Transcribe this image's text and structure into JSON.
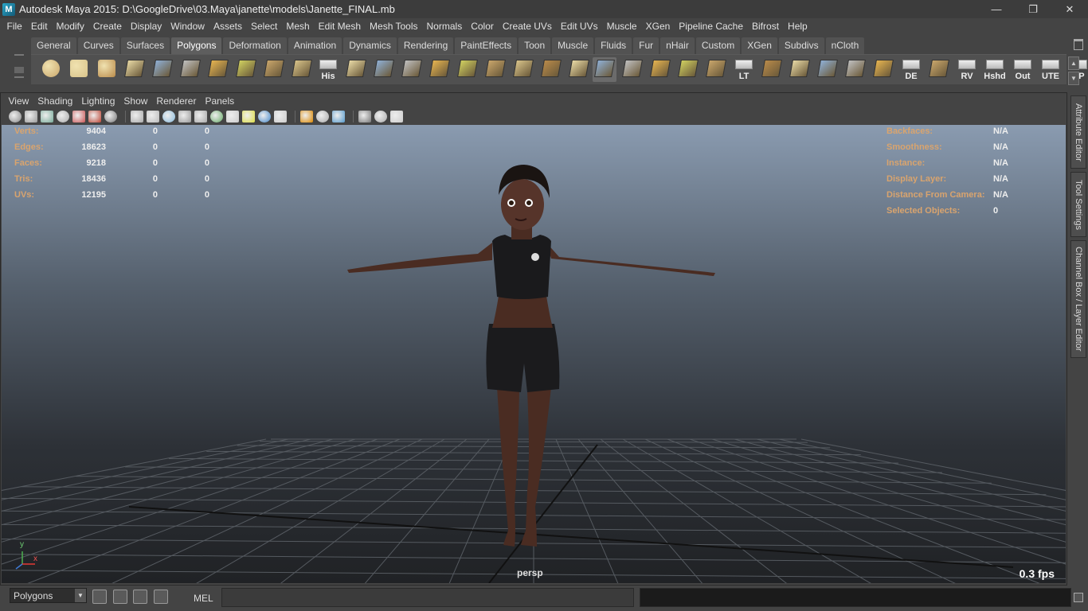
{
  "window": {
    "title": "Autodesk Maya 2015: D:\\GoogleDrive\\03.Maya\\janette\\models\\Janette_FINAL.mb",
    "app_icon": "maya-logo-icon",
    "controls": [
      "minimize-icon",
      "restore-icon",
      "close-icon"
    ]
  },
  "menubar": [
    "File",
    "Edit",
    "Modify",
    "Create",
    "Display",
    "Window",
    "Assets",
    "Select",
    "Mesh",
    "Edit Mesh",
    "Mesh Tools",
    "Normals",
    "Color",
    "Create UVs",
    "Edit UVs",
    "Muscle",
    "XGen",
    "Pipeline Cache",
    "Bifrost",
    "Help"
  ],
  "shelf": {
    "tabs": [
      "General",
      "Curves",
      "Surfaces",
      "Polygons",
      "Deformation",
      "Animation",
      "Dynamics",
      "Rendering",
      "PaintEffects",
      "Toon",
      "Muscle",
      "Fluids",
      "Fur",
      "nHair",
      "Custom",
      "XGen",
      "Subdivs",
      "nCloth"
    ],
    "active_tab": "Polygons",
    "icons": [
      {
        "name": "poly-sphere-icon",
        "label": ""
      },
      {
        "name": "poly-cube-icon",
        "label": ""
      },
      {
        "name": "poly-cylinder-icon",
        "label": ""
      },
      {
        "name": "poly-cone-icon",
        "label": ""
      },
      {
        "name": "poly-plane-icon",
        "label": ""
      },
      {
        "name": "poly-torus-icon",
        "label": ""
      },
      {
        "name": "poly-pyramid-icon",
        "label": ""
      },
      {
        "name": "poly-pipe-icon",
        "label": ""
      },
      {
        "name": "create-polygon-icon",
        "label": ""
      },
      {
        "name": "append-polygon-icon",
        "label": ""
      },
      {
        "name": "history-icon",
        "label": "His"
      },
      {
        "name": "extrude-icon",
        "label": ""
      },
      {
        "name": "bridge-icon",
        "label": ""
      },
      {
        "name": "append-icon",
        "label": ""
      },
      {
        "name": "split-icon",
        "label": ""
      },
      {
        "name": "insert-edgeloop-icon",
        "label": ""
      },
      {
        "name": "bevel-icon",
        "label": ""
      },
      {
        "name": "merge-icon",
        "label": ""
      },
      {
        "name": "wedge-icon",
        "label": ""
      },
      {
        "name": "soft-modification-icon",
        "label": ""
      },
      {
        "name": "sculpt-tool-icon",
        "label": ""
      },
      {
        "name": "lattice-icon",
        "label": ""
      },
      {
        "name": "move-manip-icon",
        "label": ""
      },
      {
        "name": "rotate-manip-icon",
        "label": ""
      },
      {
        "name": "object-space-icon",
        "label": ""
      },
      {
        "name": "lt-icon",
        "label": "LT"
      },
      {
        "name": "uv-map-icon-1",
        "label": ""
      },
      {
        "name": "uv-map-icon-2",
        "label": ""
      },
      {
        "name": "uv-map-icon-3",
        "label": ""
      },
      {
        "name": "uv-map-icon-4",
        "label": ""
      },
      {
        "name": "uv-map-icon-5",
        "label": ""
      },
      {
        "name": "de-icon",
        "label": "DE"
      },
      {
        "name": "uv-map-icon-6",
        "label": ""
      },
      {
        "name": "rv-icon",
        "label": "RV"
      },
      {
        "name": "hshd-icon",
        "label": "Hshd"
      },
      {
        "name": "out-icon",
        "label": "Out"
      },
      {
        "name": "ute-icon",
        "label": "UTE"
      },
      {
        "name": "cp-icon",
        "label": "CP"
      }
    ]
  },
  "panel": {
    "menu": [
      "View",
      "Shading",
      "Lighting",
      "Show",
      "Renderer",
      "Panels"
    ],
    "toolbar_icons": [
      "select-camera-icon",
      "camera-attributes-icon",
      "bookmarks-icon",
      "image-plane-icon",
      "grid-toggle-icon",
      "two-d-pan-icon",
      "grease-pencil-icon",
      "wireframe-icon",
      "smooth-shade-icon",
      "flat-shade-icon",
      "xray-icon",
      "texture-icon",
      "use-default-lights-icon",
      "shadows-icon",
      "ambient-occlusion-icon",
      "motion-blur-icon",
      "anti-alias-icon",
      "isolate-select-icon",
      "xray-joints-icon",
      "xray-active-icon",
      "resolution-gate-icon",
      "film-gate-icon",
      "safe-title-icon"
    ]
  },
  "viewport": {
    "camera": "persp",
    "fps": "0.3 fps",
    "stats": [
      {
        "label": "Verts:",
        "v1": "9404",
        "v2": "0",
        "v3": "0"
      },
      {
        "label": "Edges:",
        "v1": "18623",
        "v2": "0",
        "v3": "0"
      },
      {
        "label": "Faces:",
        "v1": "9218",
        "v2": "0",
        "v3": "0"
      },
      {
        "label": "Tris:",
        "v1": "18436",
        "v2": "0",
        "v3": "0"
      },
      {
        "label": "UVs:",
        "v1": "12195",
        "v2": "0",
        "v3": "0"
      }
    ],
    "info": [
      {
        "label": "Backfaces:",
        "value": "N/A"
      },
      {
        "label": "Smoothness:",
        "value": "N/A"
      },
      {
        "label": "Instance:",
        "value": "N/A"
      },
      {
        "label": "Display Layer:",
        "value": "N/A"
      },
      {
        "label": "Distance From Camera:",
        "value": "N/A"
      },
      {
        "label": "Selected Objects:",
        "value": "0"
      }
    ],
    "axis": {
      "y": "y",
      "x": "x"
    }
  },
  "side_tabs": [
    "Attribute Editor",
    "Tool Settings",
    "Channel Box / Layer Editor"
  ],
  "bottom": {
    "mode": "Polygons",
    "mel_label": "MEL",
    "command": "",
    "result": ""
  },
  "colors": {
    "hud_label": "#d9a46e",
    "viewport_top": "#8a9bb0",
    "viewport_bottom": "#202225",
    "ui_bg": "#444444",
    "active_tab": "#5e5e5e"
  }
}
